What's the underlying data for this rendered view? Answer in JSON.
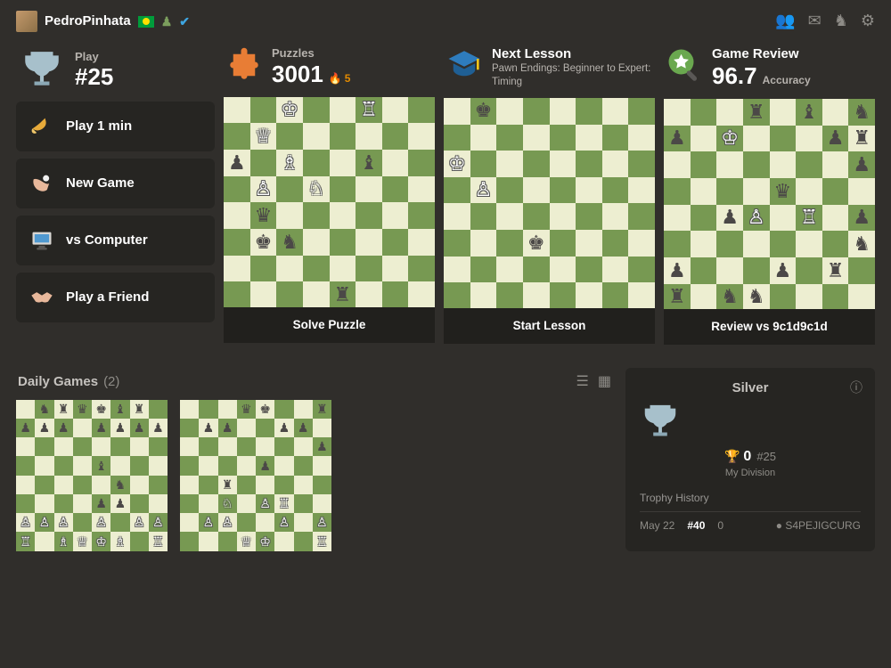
{
  "user": {
    "name": "PedroPinhata"
  },
  "play": {
    "label": "Play",
    "rank": "#25",
    "buttons": [
      "Play 1 min",
      "New Game",
      "vs Computer",
      "Play a Friend"
    ]
  },
  "cards": {
    "puzzle": {
      "title": "Puzzles",
      "value": "3001",
      "streak": "5",
      "action": "Solve Puzzle"
    },
    "lesson": {
      "title": "Next Lesson",
      "sub": "Pawn Endings: Beginner to Expert: Timing",
      "action": "Start Lesson"
    },
    "review": {
      "title": "Game Review",
      "value": "96.7",
      "accuracy": "Accuracy",
      "action": "Review vs 9c1d9c1d"
    }
  },
  "daily": {
    "title": "Daily Games",
    "count": "(2)"
  },
  "league": {
    "name": "Silver",
    "trophies": "0",
    "rank": "#25",
    "division": "My Division",
    "history_label": "Trophy History",
    "history": {
      "date": "May 22",
      "rank": "#40",
      "change": "0",
      "opponent": "S4PEJIGCURG"
    }
  },
  "boards": {
    "puzzle": "2K2R2/1Q6/p1B2b2/1P1N4/1q6/1kn5/8/4r3",
    "lesson": "1k6/8/K7/1P6/8/3k4/8/8",
    "review": "3r1b1n/p1K3pr/7p/4q3/2pP1R1p/7n/p3p1r1/r1nn4",
    "daily1": "1nrqkbr1/ppp1pppp/8/4b3/5n2/4pp2/PPP1P1PP/R1BQKB1R",
    "daily2": "3qk2r/1pp2pp1/7p/4p3/2r5/2N1PR2/1PP2P1P/3QK2R"
  }
}
